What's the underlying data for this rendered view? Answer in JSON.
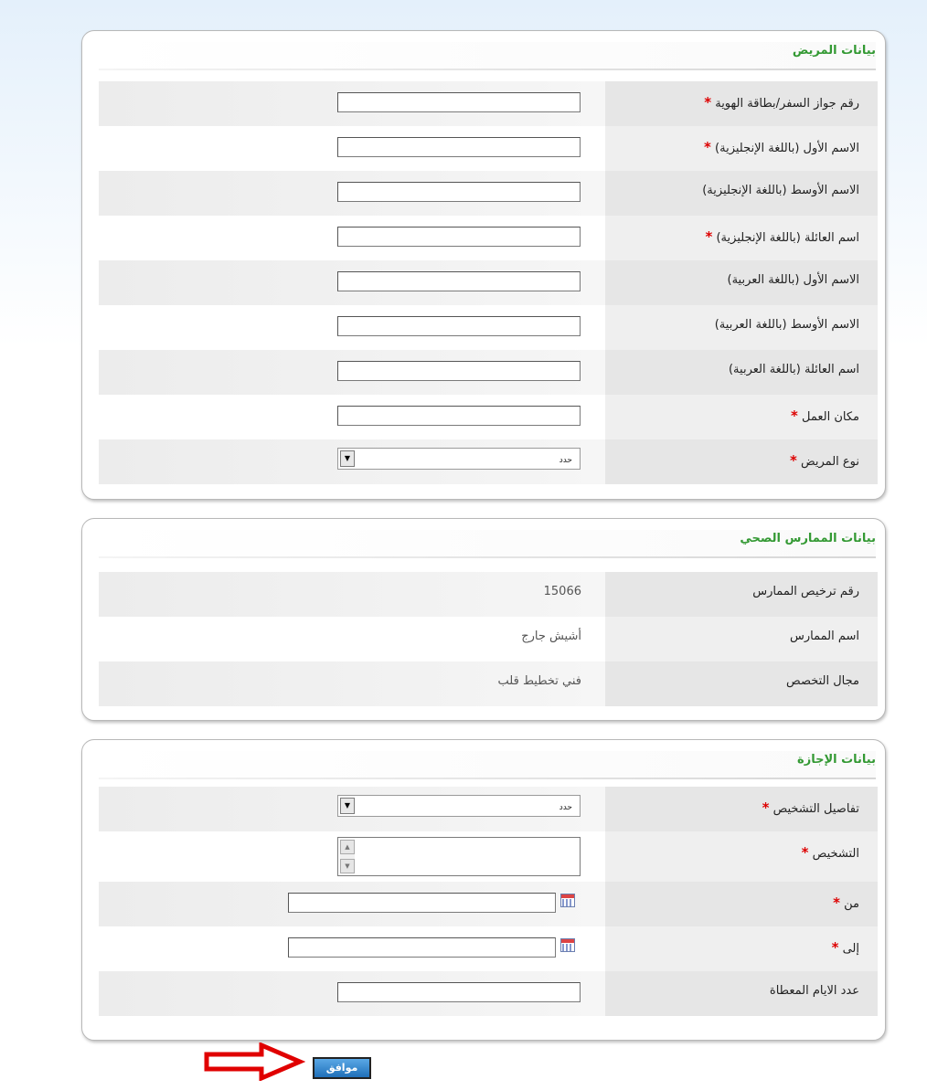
{
  "patient_section": {
    "title": "بيانات المريض",
    "fields": [
      {
        "label": "رقم جواز السفر/بطاقة الهوية",
        "required": true,
        "type": "text",
        "value": ""
      },
      {
        "label": "الاسم الأول (باللغة الإنجليزية)",
        "required": true,
        "type": "text",
        "value": ""
      },
      {
        "label": "الاسم الأوسط (باللغة الإنجليزية)",
        "required": false,
        "type": "text",
        "value": ""
      },
      {
        "label": "اسم العائلة (باللغة الإنجليزية)",
        "required": true,
        "type": "text",
        "value": ""
      },
      {
        "label": "الاسم الأول (باللغة العربية)",
        "required": false,
        "type": "text",
        "value": ""
      },
      {
        "label": "الاسم الأوسط (باللغة العربية)",
        "required": false,
        "type": "text",
        "value": ""
      },
      {
        "label": "اسم العائلة (باللغة العربية)",
        "required": false,
        "type": "text",
        "value": ""
      },
      {
        "label": "مكان العمل",
        "required": true,
        "type": "text",
        "value": ""
      },
      {
        "label": "نوع المريض",
        "required": true,
        "type": "select",
        "value": "حدد"
      }
    ]
  },
  "practitioner_section": {
    "title": "بيانات الممارس الصحي",
    "fields": [
      {
        "label": "رقم ترخيص الممارس",
        "value": "15066"
      },
      {
        "label": "اسم الممارس",
        "value": "أشيش جارج"
      },
      {
        "label": "مجال التخصص",
        "value": "فني تخطيط قلب"
      }
    ]
  },
  "leave_section": {
    "title": "بيانات الإجازة",
    "fields": [
      {
        "label": "تفاصيل التشخيص",
        "required": true,
        "type": "select",
        "value": "حدد"
      },
      {
        "label": "التشخيص",
        "required": true,
        "type": "textarea",
        "value": ""
      },
      {
        "label": "من",
        "required": true,
        "type": "date",
        "value": ""
      },
      {
        "label": "إلى",
        "required": true,
        "type": "date",
        "value": ""
      },
      {
        "label": "عدد الايام المعطاة",
        "required": false,
        "type": "text",
        "value": ""
      }
    ]
  },
  "required_marker": "*",
  "ok_button_label": "موافق",
  "colors": {
    "section_title": "#339933",
    "required": "#dd0000",
    "button": "#1f6fb8",
    "arrow": "#e00000"
  },
  "icons": {
    "calendar": "calendar-icon",
    "dropdown": "chevron-down-icon",
    "pointer": "red-arrow-icon"
  }
}
